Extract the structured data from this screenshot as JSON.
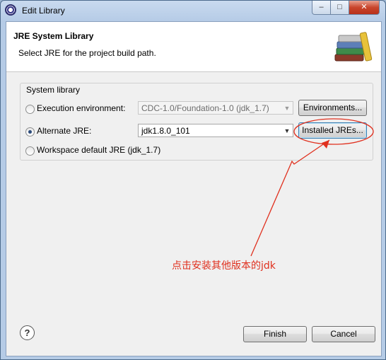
{
  "window": {
    "title": "Edit Library",
    "controls": {
      "minimize": "–",
      "maximize": "□",
      "close": "✕"
    },
    "app_icon": "eclipse-icon"
  },
  "header": {
    "title": "JRE System Library",
    "subtitle": "Select JRE for the project build path.",
    "image_icon": "books-icon"
  },
  "group": {
    "label": "System library",
    "options": [
      {
        "label": "Execution environment:",
        "selected": false,
        "combo_value": "CDC-1.0/Foundation-1.0 (jdk_1.7)",
        "combo_enabled": false,
        "button": "Environments..."
      },
      {
        "label": "Alternate JRE:",
        "selected": true,
        "combo_value": "jdk1.8.0_101",
        "combo_enabled": true,
        "button": "Installed JREs..."
      },
      {
        "label": "Workspace default JRE (jdk_1.7)",
        "selected": false
      }
    ]
  },
  "footer": {
    "help_icon": "?",
    "finish_label": "Finish",
    "cancel_label": "Cancel"
  },
  "annotation": {
    "text": "点击安装其他版本的jdk",
    "color": "#e0301e"
  }
}
